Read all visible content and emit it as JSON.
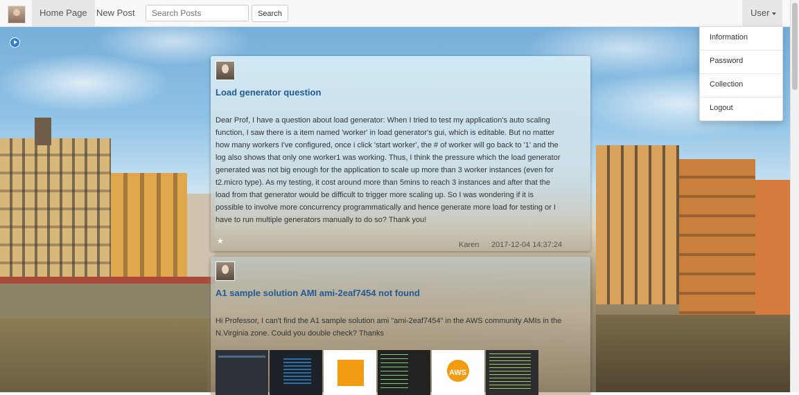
{
  "navbar": {
    "home_label": "Home Page",
    "new_post_label": "New Post",
    "search_placeholder": "Search Posts",
    "search_button_label": "Search",
    "user_menu_label": "User"
  },
  "user_dropdown": {
    "items": [
      "Information",
      "Password",
      "Collection",
      "Logout"
    ]
  },
  "posts": [
    {
      "title": "Load generator question",
      "body": "Dear Prof, I have a question about load generator: When I tried to test my application's auto scaling function, I saw there is a item named 'worker' in load generator's gui, which is editable. But no matter how many workers I've configured, once i click 'start worker', the # of worker will go back to '1' and the log also shows that only one worker1 was working. Thus, I think the pressure which the load generator generated was not big enough for the application to scale up more than 3 worker instances (even for t2.micro type). As my testing, it cost around more than 5mins to reach 3 instances and after that the load from that generator would be difficult to trigger more scaling up. So I was wondering if it is possible to involve more concurrency programmatically and hence generate more load for testing or I have to run multiple generators manually to do so? Thank you!",
      "star": "★",
      "author": "Karen",
      "timestamp": "2017-12-04 14:37:24"
    },
    {
      "title": "A1 sample solution AMI ami-2eaf7454 not found",
      "body": "Hi Professor, I can't find the A1 sample solution ami \"ami-2eaf7454\" in the AWS community AMIs in the N.Virginia zone. Could you double check? Thanks",
      "thumb_aws_text": "AWS"
    }
  ],
  "colors": {
    "title_blue": "#235a93",
    "nav_bg": "#f8f8f8",
    "toggle_blue": "#2f7fd1"
  }
}
